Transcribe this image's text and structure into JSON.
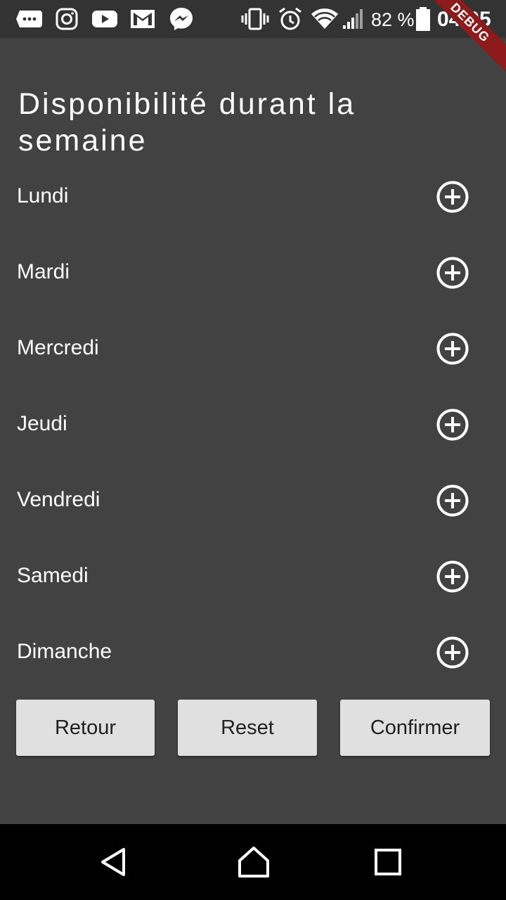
{
  "status_bar": {
    "battery_percent": "82 %",
    "time": "04:05",
    "left_icons": [
      "messages-icon",
      "instagram-icon",
      "youtube-icon",
      "gmail-icon",
      "messenger-icon"
    ],
    "right_icons": [
      "vibrate-icon",
      "alarm-icon",
      "wifi-icon",
      "cell-signal-icon",
      "battery-icon"
    ]
  },
  "debug_banner": "DEBUG",
  "main": {
    "title": "Disponibilité durant la semaine",
    "days": [
      {
        "label": "Lundi"
      },
      {
        "label": "Mardi"
      },
      {
        "label": "Mercredi"
      },
      {
        "label": "Jeudi"
      },
      {
        "label": "Vendredi"
      },
      {
        "label": "Samedi"
      },
      {
        "label": "Dimanche"
      }
    ],
    "add_icon": "add-circle-outline-icon",
    "buttons": {
      "back": "Retour",
      "reset": "Reset",
      "confirm": "Confirmer"
    }
  },
  "nav_bar": {
    "icons": [
      "back-icon",
      "home-icon",
      "recents-icon"
    ]
  },
  "colors": {
    "background": "#424242",
    "status_bar": "#333333",
    "button_bg": "#e0e0e0",
    "button_text": "#212121",
    "debug_banner": "#8e1b1b",
    "nav_bar": "#000000"
  }
}
